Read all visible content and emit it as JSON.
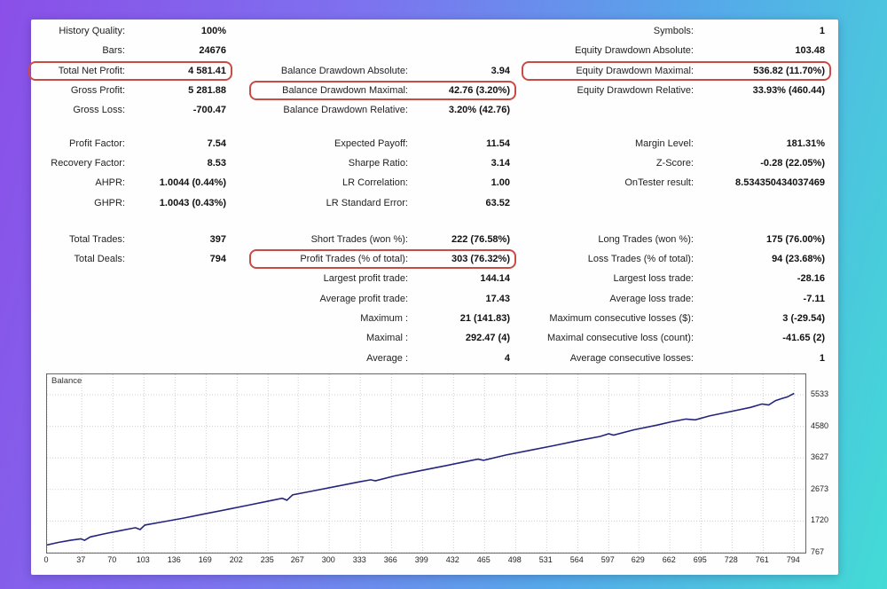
{
  "report": {
    "columns": [
      {
        "name": "left",
        "blocks": [
          [
            {
              "l": "History Quality:",
              "v": "100%"
            },
            {
              "l": "Bars:",
              "v": "24676"
            },
            {
              "l": "Total Net Profit:",
              "v": "4 581.41",
              "box": true
            },
            {
              "l": "Gross Profit:",
              "v": "5 281.88"
            },
            {
              "l": "Gross Loss:",
              "v": "-700.47"
            }
          ],
          [
            {
              "l": "Profit Factor:",
              "v": "7.54"
            },
            {
              "l": "Recovery Factor:",
              "v": "8.53"
            },
            {
              "l": "AHPR:",
              "v": "1.0044 (0.44%)"
            },
            {
              "l": "GHPR:",
              "v": "1.0043 (0.43%)"
            }
          ],
          [
            {
              "l": "Total Trades:",
              "v": "397"
            },
            {
              "l": "Total Deals:",
              "v": "794"
            }
          ]
        ]
      },
      {
        "name": "middle",
        "blocks": [
          [
            {
              "l": "",
              "v": ""
            },
            {
              "l": "",
              "v": ""
            },
            {
              "l": "Balance Drawdown Absolute:",
              "v": "3.94"
            },
            {
              "l": "Balance Drawdown Maximal:",
              "v": "42.76 (3.20%)",
              "box": true
            },
            {
              "l": "Balance Drawdown Relative:",
              "v": "3.20% (42.76)"
            }
          ],
          [
            {
              "l": "Expected Payoff:",
              "v": "11.54"
            },
            {
              "l": "Sharpe Ratio:",
              "v": "3.14"
            },
            {
              "l": "LR Correlation:",
              "v": "1.00"
            },
            {
              "l": "LR Standard Error:",
              "v": "63.52"
            }
          ],
          [
            {
              "l": "Short Trades (won %):",
              "v": "222 (76.58%)"
            },
            {
              "l": "Profit Trades (% of total):",
              "v": "303 (76.32%)",
              "box": true
            },
            {
              "l": "Largest profit trade:",
              "v": "144.14"
            },
            {
              "l": "Average profit trade:",
              "v": "17.43"
            },
            {
              "l": "Maximum :",
              "v": "21 (141.83)"
            },
            {
              "l": "Maximal :",
              "v": "292.47 (4)"
            },
            {
              "l": "Average :",
              "v": "4"
            }
          ]
        ]
      },
      {
        "name": "right",
        "blocks": [
          [
            {
              "l": "Symbols:",
              "v": "1"
            },
            {
              "l": "Equity Drawdown Absolute:",
              "v": "103.48"
            },
            {
              "l": "Equity Drawdown Maximal:",
              "v": "536.82 (11.70%)",
              "box": true
            },
            {
              "l": "Equity Drawdown Relative:",
              "v": "33.93% (460.44)"
            },
            {
              "l": "",
              "v": ""
            }
          ],
          [
            {
              "l": "Margin Level:",
              "v": "181.31%"
            },
            {
              "l": "Z-Score:",
              "v": "-0.28 (22.05%)"
            },
            {
              "l": "OnTester result:",
              "v": "8.534350434037469"
            },
            {
              "l": "",
              "v": ""
            }
          ],
          [
            {
              "l": "Long Trades (won %):",
              "v": "175 (76.00%)"
            },
            {
              "l": "Loss Trades (% of total):",
              "v": "94 (23.68%)"
            },
            {
              "l": "Largest loss trade:",
              "v": "-28.16"
            },
            {
              "l": "Average loss trade:",
              "v": "-7.11"
            },
            {
              "l": "Maximum consecutive losses ($):",
              "v": "3 (-29.54)"
            },
            {
              "l": "Maximal consecutive loss (count):",
              "v": "-41.65 (2)"
            },
            {
              "l": "Average consecutive losses:",
              "v": "1"
            }
          ]
        ]
      }
    ]
  },
  "chart_data": {
    "type": "line",
    "title": "Balance",
    "xlabel": "",
    "ylabel": "",
    "grid": true,
    "legend_position": "top-left-inline",
    "line_color": "#24247e",
    "xlim": [
      0,
      806
    ],
    "ylim": [
      767,
      6150
    ],
    "x_ticks": [
      0,
      37,
      70,
      103,
      136,
      169,
      202,
      235,
      267,
      300,
      333,
      366,
      399,
      432,
      465,
      498,
      531,
      564,
      597,
      629,
      662,
      695,
      728,
      761,
      794
    ],
    "y_ticks": [
      5533,
      4580,
      3627,
      2673,
      1720,
      767
    ],
    "series": [
      {
        "name": "Balance",
        "points": [
          [
            0,
            1000
          ],
          [
            12,
            1075
          ],
          [
            25,
            1140
          ],
          [
            36,
            1185
          ],
          [
            40,
            1140
          ],
          [
            46,
            1240
          ],
          [
            60,
            1330
          ],
          [
            78,
            1430
          ],
          [
            94,
            1520
          ],
          [
            99,
            1465
          ],
          [
            104,
            1600
          ],
          [
            122,
            1690
          ],
          [
            145,
            1810
          ],
          [
            168,
            1940
          ],
          [
            192,
            2075
          ],
          [
            214,
            2200
          ],
          [
            238,
            2340
          ],
          [
            250,
            2410
          ],
          [
            255,
            2350
          ],
          [
            261,
            2510
          ],
          [
            283,
            2630
          ],
          [
            308,
            2770
          ],
          [
            332,
            2905
          ],
          [
            344,
            2965
          ],
          [
            349,
            2935
          ],
          [
            369,
            3080
          ],
          [
            394,
            3225
          ],
          [
            418,
            3360
          ],
          [
            443,
            3505
          ],
          [
            458,
            3590
          ],
          [
            464,
            3555
          ],
          [
            488,
            3715
          ],
          [
            513,
            3855
          ],
          [
            538,
            3995
          ],
          [
            562,
            4135
          ],
          [
            588,
            4275
          ],
          [
            597,
            4355
          ],
          [
            602,
            4315
          ],
          [
            624,
            4475
          ],
          [
            648,
            4615
          ],
          [
            663,
            4715
          ],
          [
            679,
            4800
          ],
          [
            689,
            4775
          ],
          [
            704,
            4895
          ],
          [
            728,
            5035
          ],
          [
            748,
            5155
          ],
          [
            760,
            5255
          ],
          [
            767,
            5225
          ],
          [
            774,
            5355
          ],
          [
            781,
            5420
          ],
          [
            787,
            5470
          ],
          [
            794,
            5575
          ]
        ]
      }
    ]
  },
  "colors": {
    "highlight_box": "#c84b44",
    "balance_line": "#24247e",
    "gradient_left": "#8a4fe8",
    "gradient_right": "#43dbd6"
  }
}
